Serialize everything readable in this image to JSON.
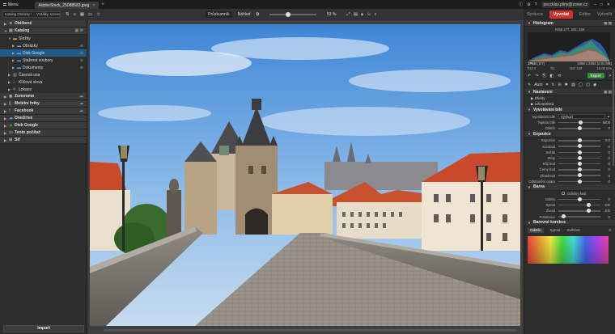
{
  "titlebar": {
    "menu_label": "Menu",
    "tab_title": "AdobeStock_25088583.jpeg",
    "tab_close": "×",
    "tab_add": "+",
    "user_email": "peccklav.pliny@zoner.cz",
    "window_controls": [
      "–",
      "□",
      "✕"
    ]
  },
  "toolbar": {
    "path": "Katalog Obrázky \\ ... Vzdálky, screenshots",
    "icons": [
      "filter-icon",
      "sort-icon",
      "grid-icon",
      "folder-icon",
      "star-icon"
    ],
    "view_mode": "Průzkumník",
    "preview_mode": "Náhled",
    "zoom_pct": "53 %",
    "zoom_icons": [
      "fit-icon",
      "grid-icon",
      "lock-icon",
      "user-icon",
      "search-icon"
    ]
  },
  "modules": {
    "items": [
      "Správce",
      "Vyvolat",
      "Editor",
      "Vytvořit"
    ],
    "active": "Vyvolat"
  },
  "navigator": {
    "favorites": "Oblíbené",
    "catalog": "Katalog",
    "folders": "Složky",
    "folder_items": [
      "Obrázky",
      "Disk Google",
      "Stažené soubory",
      "Dokumenty"
    ],
    "timeline": "Časová osa",
    "keywords": "Klíčová slova",
    "locations": "Lokace",
    "zonerama": "Zonerama",
    "mobile": "Mobilní fotky",
    "facebook": "Facebook",
    "onedrive": "OneDrive",
    "gdrive": "Disk Google",
    "this_pc": "Tento počítač",
    "network": "Síť",
    "import_label": "Import"
  },
  "histogram": {
    "title": "Histogram",
    "rgb": "RGB 177, 202, 238",
    "format": "JPEG",
    "index": "(2/7)",
    "dims": "3456 x 2304 (2.91 MB)",
    "aperture": "f/13 s",
    "exposure": "f11",
    "iso": "ISO 100",
    "focal": "18.00 mm"
  },
  "actions": {
    "export_label": "Export"
  },
  "tools": {
    "auto_label": "Auto"
  },
  "presets": {
    "title": "Nastavení",
    "items": [
      "Efekty",
      "Uživatelská"
    ]
  },
  "white_balance": {
    "title": "Vyvolávání bílé",
    "wb_label": "Vyvolávání bílé",
    "wb_value": "Výchozí",
    "temp_label": "Teplota bílé",
    "temp_value": "5600",
    "temp_frac": 0.52,
    "tint_label": "Odstín",
    "tint_value": "0",
    "tint_frac": 0.5
  },
  "exposure": {
    "title": "Expozice",
    "rows": [
      {
        "label": "Expozice",
        "value": "0.0",
        "frac": 0.5
      },
      {
        "label": "Kontrast",
        "value": "0",
        "frac": 0.5
      },
      {
        "label": "Světla",
        "value": "0",
        "frac": 0.5
      },
      {
        "label": "Stíny",
        "value": "0",
        "frac": 0.5
      },
      {
        "label": "Bílý bod",
        "value": "0",
        "frac": 0.5
      },
      {
        "label": "Černý bod",
        "value": "0",
        "frac": 0.5
      },
      {
        "label": "Zřetelnost",
        "value": "0",
        "frac": 0.5
      },
      {
        "label": "Odstranění oparu",
        "value": "0",
        "frac": 0.5
      }
    ]
  },
  "color": {
    "title": "Barva",
    "grayscale_label": "Odstíny šedi",
    "rows": [
      {
        "label": "Odstín",
        "value": "0",
        "frac": 0.5
      },
      {
        "label": "Sytost",
        "value": "100",
        "frac": 0.72
      },
      {
        "label": "Živost",
        "value": "100",
        "frac": 0.72
      },
      {
        "label": "Polarizace",
        "value": "0",
        "frac": 0.12
      }
    ]
  },
  "color_correction": {
    "title": "Barevné korekce",
    "tabs": [
      "Odstín",
      "Sytost",
      "Světlost"
    ],
    "active_tab": "Odstín"
  }
}
